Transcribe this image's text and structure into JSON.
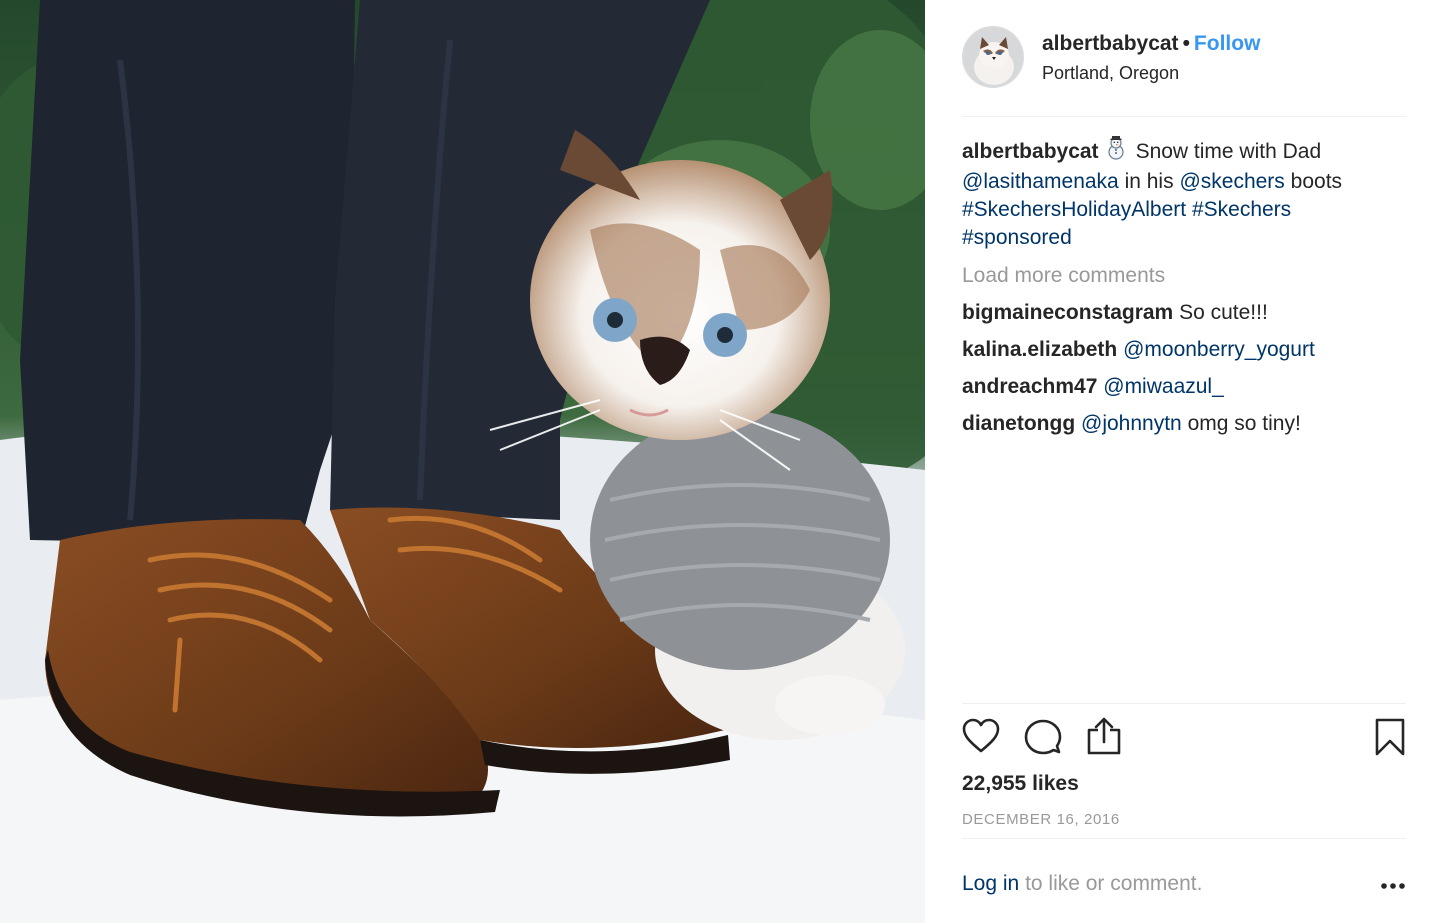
{
  "post": {
    "username": "albertbabycat",
    "follow_label": "Follow",
    "separator": "•",
    "location": "Portland, Oregon"
  },
  "caption": {
    "username": "albertbabycat",
    "emoji_icon": "snowman-icon",
    "text_1": "Snow time with Dad",
    "mention_1": "@lasithamenaka",
    "text_2": "in his",
    "mention_2": "@skechers",
    "text_3": "boots",
    "hashtags": [
      "#SkechersHolidayAlbert",
      "#Skechers",
      "#sponsored"
    ]
  },
  "load_more_label": "Load more comments",
  "comments": [
    {
      "user": "bigmaineconstagram",
      "mention": "",
      "text": "So cute!!!"
    },
    {
      "user": "kalina.elizabeth",
      "mention": "@moonberry_yogurt",
      "text": ""
    },
    {
      "user": "andreachm47",
      "mention": "@miwaazul_",
      "text": ""
    },
    {
      "user": "dianetongg",
      "mention": "@johnnytn",
      "text": "omg so tiny!"
    }
  ],
  "actions": {
    "icons": [
      "heart-icon",
      "comment-icon",
      "share-icon",
      "bookmark-icon"
    ]
  },
  "likes": "22,955 likes",
  "date": "DECEMBER 16, 2016",
  "footer": {
    "login_link": "Log in",
    "login_text": "to like or comment.",
    "more_icon": "more-options-icon"
  },
  "colors": {
    "follow": "#3897f0",
    "link": "#003569",
    "muted": "#999999",
    "text": "#262626",
    "divider": "#efefef"
  }
}
